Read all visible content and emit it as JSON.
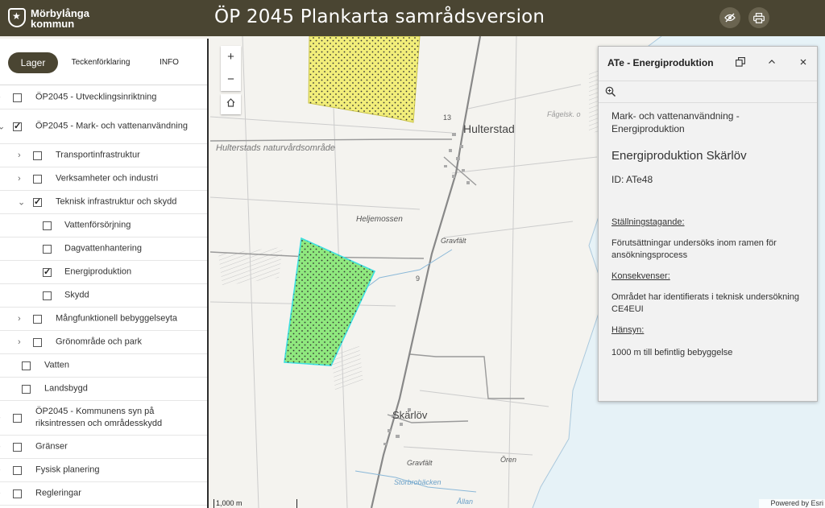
{
  "header": {
    "logo_line1": "Mörbylånga",
    "logo_line2": "kommun",
    "title": "ÖP 2045  Plankarta samrådsversion",
    "buttons": [
      {
        "icon": "eye-slash-icon"
      },
      {
        "icon": "print-icon"
      }
    ]
  },
  "tabs": {
    "layers": "Lager",
    "legend": "Teckenförklaring",
    "info": "INFO"
  },
  "layers": [
    {
      "label": "ÖP2045 - Utvecklingsinriktning",
      "level": 0,
      "checked": false,
      "expand": "collapsed"
    },
    {
      "label": "ÖP2045 - Mark- och vattenanvändning",
      "level": 0,
      "checked": true,
      "expand": "expanded"
    },
    {
      "label": "Transportinfrastruktur",
      "level": 1,
      "checked": false,
      "expand": "collapsed"
    },
    {
      "label": "Verksamheter och industri",
      "level": 1,
      "checked": false,
      "expand": "collapsed"
    },
    {
      "label": "Teknisk infrastruktur och skydd",
      "level": 1,
      "checked": true,
      "expand": "expanded"
    },
    {
      "label": "Vattenförsörjning",
      "level": 2,
      "checked": false,
      "expand": "none"
    },
    {
      "label": "Dagvattenhantering",
      "level": 2,
      "checked": false,
      "expand": "none"
    },
    {
      "label": "Energiproduktion",
      "level": 2,
      "checked": true,
      "expand": "none"
    },
    {
      "label": "Skydd",
      "level": 2,
      "checked": false,
      "expand": "none"
    },
    {
      "label": "Mångfunktionell bebyggelseyta",
      "level": 1,
      "checked": false,
      "expand": "collapsed"
    },
    {
      "label": "Grönområde och park",
      "level": 1,
      "checked": false,
      "expand": "collapsed"
    },
    {
      "label": "Vatten",
      "level": 3,
      "checked": false,
      "expand": "none"
    },
    {
      "label": "Landsbygd",
      "level": 3,
      "checked": false,
      "expand": "none"
    },
    {
      "label": "ÖP2045 - Kommunens syn på riksintressen och områdesskydd",
      "level": 0,
      "checked": false,
      "expand": "collapsed"
    },
    {
      "label": "Gränser",
      "level": 0,
      "checked": false,
      "expand": "collapsed"
    },
    {
      "label": "Fysisk planering",
      "level": 0,
      "checked": false,
      "expand": "collapsed"
    },
    {
      "label": "Regleringar",
      "level": 0,
      "checked": false,
      "expand": "collapsed"
    }
  ],
  "map": {
    "zoom_in": "+",
    "zoom_out": "−",
    "home_icon": "home-icon",
    "labels": {
      "hulterstad": "Hulterstad",
      "naturvard": "Hulterstads naturvårdsområde",
      "heljemossen": "Heljemossen",
      "gravfalt1": "Gravfält",
      "gravfalt2": "Gravfält",
      "skarlov": "Skärlöv",
      "oren": "Ören",
      "storbrobacken": "Storbrobäcken",
      "fagelsk": "Fågelsk. o",
      "allan": "Ållan",
      "road13": "13",
      "road9": "9"
    },
    "scale_text": "1,000 m",
    "attribution": "Powered by Esri",
    "colors": {
      "yellow_zone": "#f2ee7a",
      "green_zone": "#8fe87e",
      "green_zone_stroke": "#3ee0e0",
      "sea": "#e6f2f7"
    }
  },
  "popup": {
    "title": "ATe - Energiproduktion",
    "subtitle": "Mark- och vattenanvändning - Energiproduktion",
    "name": "Energiproduktion Skärlöv",
    "id_text": "ID: ATe48",
    "sections": [
      {
        "heading": "Ställningstagande:",
        "text": "Förutsättningar undersöks inom ramen för ansökningsprocess"
      },
      {
        "heading": "Konsekvenser:",
        "text": "Området har identifierats i teknisk undersökning CE4EUI"
      },
      {
        "heading": "Hänsyn:",
        "text": "1000 m till befintlig bebyggelse"
      }
    ]
  }
}
